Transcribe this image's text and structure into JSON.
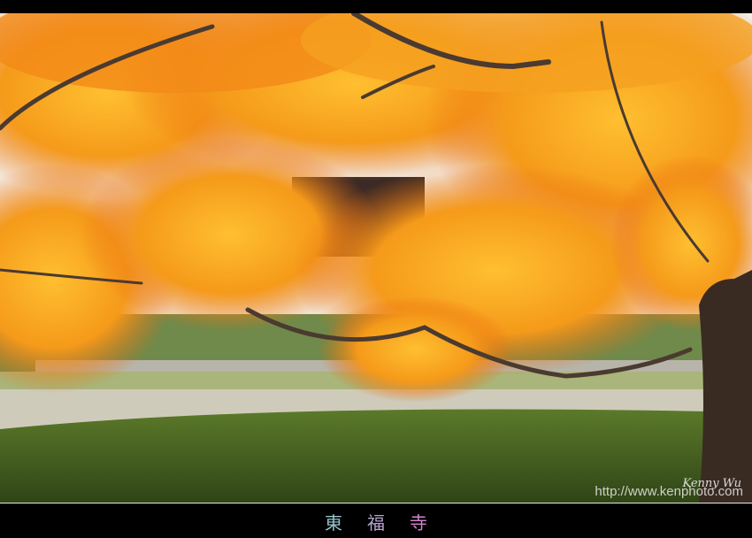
{
  "photo": {
    "subject": "autumn maple tree",
    "colors": {
      "foliage": "#f39a1c",
      "foliage_light": "#ffc23a",
      "moss": "#3f5a1e",
      "path": "#c9c6b4",
      "trunk": "#3a2b22"
    }
  },
  "watermark": {
    "signature": "Kenny Wu",
    "url": "http://www.kenphoto.com"
  },
  "caption": "東福寺"
}
